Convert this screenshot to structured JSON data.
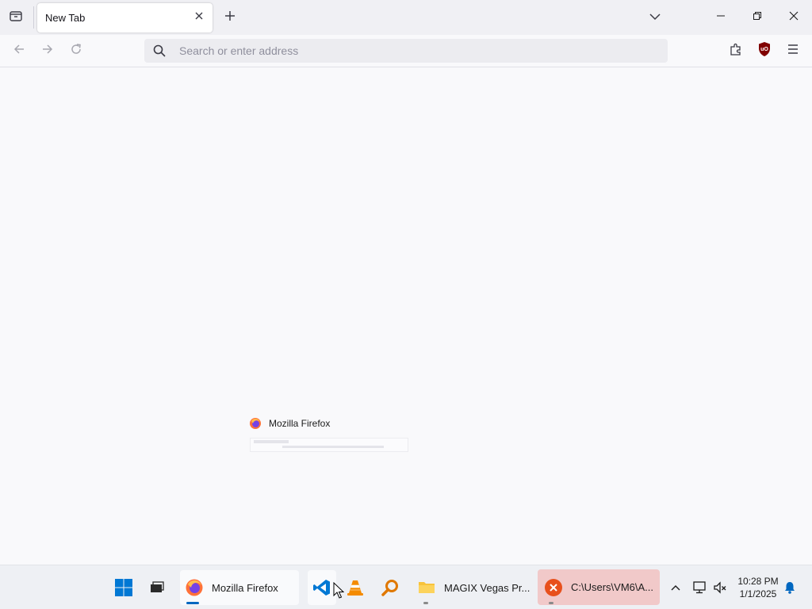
{
  "browser": {
    "tab": {
      "title": "New Tab"
    },
    "urlbar": {
      "placeholder": "Search or enter address"
    },
    "icons": [
      "tab-list-icon",
      "close-icon",
      "plus-icon",
      "chevron-down-icon",
      "minimize-icon",
      "restore-icon",
      "close-icon",
      "back-arrow-icon",
      "forward-arrow-icon",
      "reload-icon",
      "search-icon",
      "extensions-icon",
      "ublock-shield-icon",
      "hamburger-menu-icon"
    ],
    "colors": {
      "ublock": "#800000",
      "tabstrip": "#f0f0f4"
    }
  },
  "preview": {
    "title": "Mozilla Firefox"
  },
  "taskbar": {
    "apps": {
      "firefox": {
        "label": "Mozilla Firefox"
      },
      "explorer": {
        "label": "MAGIX Vegas Pr..."
      },
      "error": {
        "label": "C:\\Users\\VM6\\A..."
      }
    },
    "clock": {
      "time": "10:28 PM",
      "date": "1/1/2025"
    },
    "colors": {
      "active_indicator": "#0067c0",
      "error_bg": "#f1c9c9"
    }
  }
}
